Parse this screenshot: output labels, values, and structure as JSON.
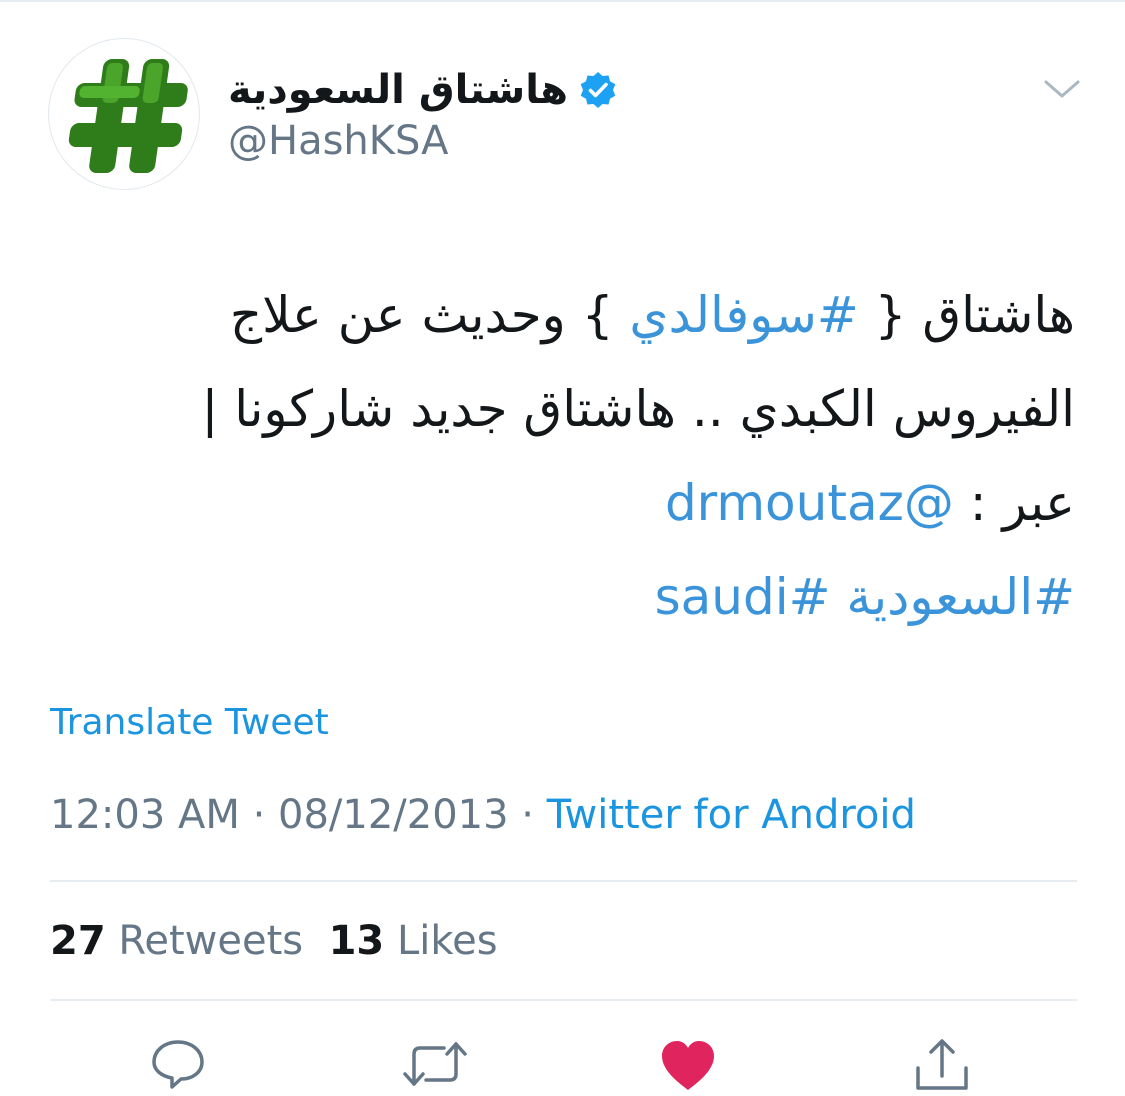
{
  "tweet": {
    "author": {
      "display_name": "هاشتاق السعودية",
      "handle": "@HashKSA",
      "verified": true,
      "avatar_icon": "hashtag-logo-icon",
      "avatar_color": "#3a8f22"
    },
    "body": {
      "line1_a": "هاشتاق { ",
      "line1_hashtag": "#سوفالدي",
      "line1_b": " } وحديث عن علاج",
      "line2": "الفيروس الكبدي .. هاشتاق جديد شاركونا |",
      "line3_a": "عبر : ",
      "line3_mention": "@drmoutaz",
      "line4_hashtag1": "#السعودية",
      "line4_hashtag2": "#saudi"
    },
    "translate_label": "Translate Tweet",
    "time": "12:03 AM",
    "date": "08/12/2013",
    "separator": " · ",
    "source": "Twitter for Android",
    "stats": {
      "retweets_count": "27",
      "retweets_label": "Retweets",
      "likes_count": "13",
      "likes_label": "Likes"
    },
    "actions": {
      "reply_icon": "reply-icon",
      "retweet_icon": "retweet-icon",
      "like_icon": "heart-icon",
      "share_icon": "share-icon",
      "liked": true
    }
  },
  "colors": {
    "link": "#1b95e0",
    "muted": "#657786",
    "text": "#14171a",
    "like": "#e0245e",
    "divider": "#e6ecf0"
  }
}
